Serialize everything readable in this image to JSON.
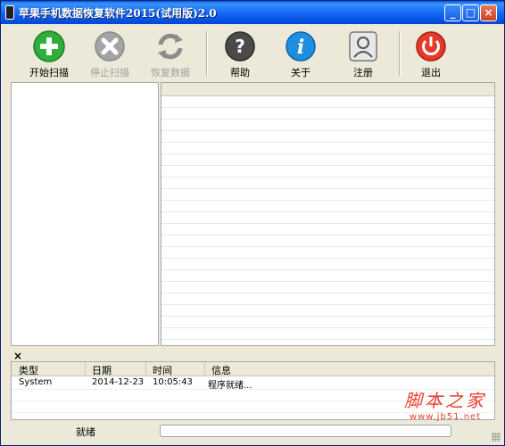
{
  "window": {
    "title": "苹果手机数据恢复软件2015(试用版)2.0",
    "buttons": {
      "minimize": "_",
      "maximize": "□",
      "close": "×"
    }
  },
  "toolbar": {
    "items": [
      {
        "label": "开始扫描",
        "icon": "plus-icon",
        "enabled": true,
        "color": "#2fae3c"
      },
      {
        "label": "停止扫描",
        "icon": "stop-icon",
        "enabled": false,
        "color": "#9a9a9a"
      },
      {
        "label": "恢复数据",
        "icon": "refresh-icon",
        "enabled": false,
        "color": "#9a9a9a"
      },
      {
        "label": "帮助",
        "icon": "help-icon",
        "enabled": true,
        "color": "#555555"
      },
      {
        "label": "关于",
        "icon": "info-icon",
        "enabled": true,
        "color": "#1e8fe0"
      },
      {
        "label": "注册",
        "icon": "user-icon",
        "enabled": true,
        "color": "#777777"
      },
      {
        "label": "退出",
        "icon": "power-icon",
        "enabled": true,
        "color": "#e33a2a"
      }
    ]
  },
  "log_panel": {
    "close_glyph": "×",
    "columns": [
      "类型",
      "日期",
      "时间",
      "信息"
    ],
    "rows": [
      {
        "type": "System",
        "date": "2014-12-23",
        "time": "10:05:43",
        "message": "程序就绪..."
      }
    ]
  },
  "status": {
    "text": "就绪"
  },
  "watermark": {
    "text": "脚本之家",
    "url": "www.jb51.net"
  }
}
